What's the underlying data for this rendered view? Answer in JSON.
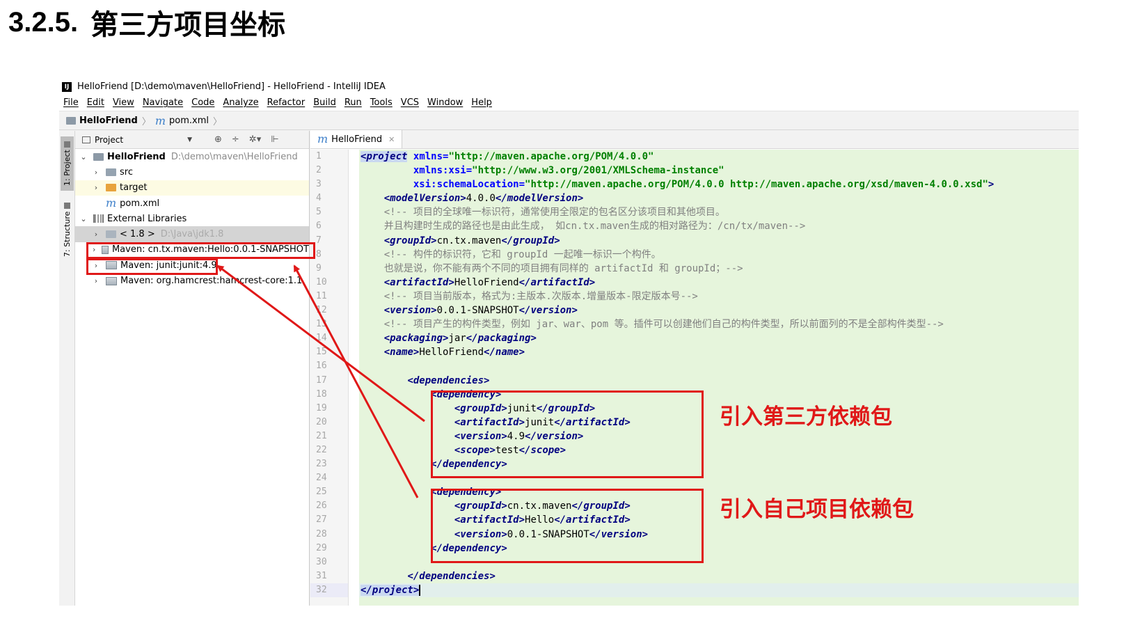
{
  "heading": {
    "number": "3.2.5.",
    "title": "第三方项目坐标"
  },
  "window": {
    "app_icon": "IJ",
    "title": "HelloFriend [D:\\demo\\maven\\HelloFriend] - HelloFriend - IntelliJ IDEA"
  },
  "menu": [
    "File",
    "Edit",
    "View",
    "Navigate",
    "Code",
    "Analyze",
    "Refactor",
    "Build",
    "Run",
    "Tools",
    "VCS",
    "Window",
    "Help"
  ],
  "breadcrumb": {
    "project": "HelloFriend",
    "file": "pom.xml"
  },
  "side_tabs": {
    "project": "1: Project",
    "structure": "7: Structure"
  },
  "project_panel": {
    "title": "Project",
    "tools": [
      "⊕",
      "÷",
      "✲▾",
      "⊩"
    ],
    "tree": [
      {
        "arrow": "⌄",
        "name": "HelloFriend",
        "path": "D:\\demo\\maven\\HelloFriend",
        "icon": "project-folder-icon"
      },
      {
        "arrow": "›",
        "name": "src",
        "icon": "folder-icon"
      },
      {
        "arrow": "›",
        "name": "target",
        "icon": "folder-orange-icon"
      },
      {
        "arrow": "",
        "name": "pom.xml",
        "icon": "maven-file-icon"
      },
      {
        "arrow": "⌄",
        "name": "External Libraries",
        "icon": "library-icon"
      },
      {
        "arrow": "›",
        "name": "< 1.8 >",
        "path": "D:\\Java\\jdk1.8",
        "icon": "jdk-icon"
      },
      {
        "arrow": "›",
        "name": "Maven: cn.tx.maven:Hello:0.0.1-SNAPSHOT",
        "icon": "jar-icon"
      },
      {
        "arrow": "›",
        "name": "Maven: junit:junit:4.9",
        "icon": "jar-icon"
      },
      {
        "arrow": "›",
        "name": "Maven: org.hamcrest:hamcrest-core:1.1",
        "icon": "jar-icon"
      }
    ]
  },
  "editor": {
    "tab": "HelloFriend",
    "line_numbers": [
      "1",
      "2",
      "3",
      "4",
      "5",
      "6",
      "7",
      "8",
      "9",
      "10",
      "11",
      "12",
      "13",
      "14",
      "15",
      "16",
      "17",
      "18",
      "19",
      "20",
      "21",
      "22",
      "23",
      "24",
      "25",
      "26",
      "27",
      "28",
      "29",
      "30",
      "31",
      "32"
    ],
    "lines": {
      "l1_tag": "project",
      "l1_attr": "xmlns",
      "l1_val": "\"http://maven.apache.org/POM/4.0.0\"",
      "l2_attr": "xmlns:xsi",
      "l2_val": "\"http://www.w3.org/2001/XMLSchema-instance\"",
      "l3_attr": "xsi:schemaLocation",
      "l3_val": "\"http://maven.apache.org/POM/4.0.0 http://maven.apache.org/xsd/maven-4.0.0.xsd\"",
      "l4_tag": "modelVersion",
      "l4_text": "4.0.0",
      "l5_comment": "<!-- 项目的全球唯一标识符，通常使用全限定的包名区分该项目和其他项目。",
      "l6_comment": "并且构建时生成的路径也是由此生成， 如cn.tx.maven生成的相对路径为：/cn/tx/maven-->",
      "l7_tag": "groupId",
      "l7_text": "cn.tx.maven",
      "l8_comment": "<!-- 构件的标识符，它和 groupId 一起唯一标识一个构件。",
      "l9_comment": "也就是说，你不能有两个不同的项目拥有同样的 artifactId 和 groupId；-->",
      "l10_tag": "artifactId",
      "l10_text": "HelloFriend",
      "l11_comment": "<!-- 项目当前版本，格式为:主版本.次版本.增量版本-限定版本号-->",
      "l12_tag": "version",
      "l12_text": "0.0.1-SNAPSHOT",
      "l13_comment": "<!-- 项目产生的构件类型，例如 jar、war、pom 等。插件可以创建他们自己的构件类型，所以前面列的不是全部构件类型-->",
      "l14_tag": "packaging",
      "l14_text": "jar",
      "l15_tag": "name",
      "l15_text": "HelloFriend",
      "deps_tag": "dependencies",
      "dep_tag": "dependency",
      "d1_group_tag": "groupId",
      "d1_group": "junit",
      "d1_artifact_tag": "artifactId",
      "d1_artifact": "junit",
      "d1_version_tag": "version",
      "d1_version": "4.9",
      "d1_scope_tag": "scope",
      "d1_scope": "test",
      "d2_group_tag": "groupId",
      "d2_group": "cn.tx.maven",
      "d2_artifact_tag": "artifactId",
      "d2_artifact": "Hello",
      "d2_version_tag": "version",
      "d2_version": "0.0.1-SNAPSHOT",
      "l32_tag": "project"
    }
  },
  "annotations": {
    "third_party": "引入第三方依赖包",
    "own_project": "引入自己项目依赖包"
  },
  "colors": {
    "annotation_red": "#e01818",
    "code_bg": "#e6f5dc",
    "tag": "#000080",
    "attr": "#0000ff",
    "value": "#008000",
    "comment": "#808080"
  }
}
